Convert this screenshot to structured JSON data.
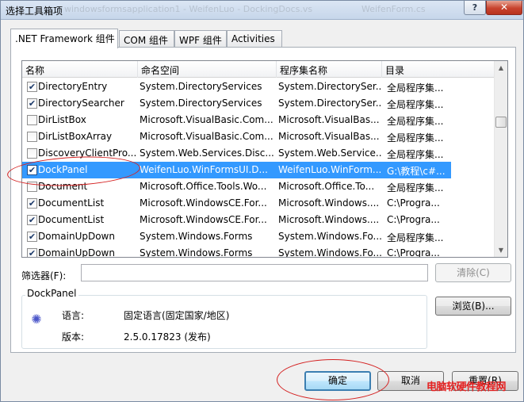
{
  "window": {
    "title": "选择工具箱项",
    "title_ghost": "windowsformsapplication1 - WeifenLuo - DockingDocs.vs",
    "title_ghost2": "WeifenForm.cs",
    "help_label": "?",
    "close_label": "✕"
  },
  "tabs": [
    {
      "label": ".NET Framework 组件"
    },
    {
      "label": "COM 组件"
    },
    {
      "label": "WPF 组件"
    },
    {
      "label": "Activities"
    }
  ],
  "list": {
    "columns": [
      "名称",
      "命名空间",
      "程序集名称",
      "目录"
    ],
    "rows": [
      {
        "checked": true,
        "name": "DirectoryEntry",
        "ns": "System.DirectoryServices",
        "asm": "System.DirectorySer...",
        "dir": "全局程序集..."
      },
      {
        "checked": true,
        "name": "DirectorySearcher",
        "ns": "System.DirectoryServices",
        "asm": "System.DirectorySer...",
        "dir": "全局程序集..."
      },
      {
        "checked": false,
        "name": "DirListBox",
        "ns": "Microsoft.VisualBasic.Com...",
        "asm": "Microsoft.VisualBas...",
        "dir": "全局程序集..."
      },
      {
        "checked": false,
        "name": "DirListBoxArray",
        "ns": "Microsoft.VisualBasic.Com...",
        "asm": "Microsoft.VisualBas...",
        "dir": "全局程序集..."
      },
      {
        "checked": false,
        "name": "DiscoveryClientPro...",
        "ns": "System.Web.Services.Disc...",
        "asm": "System.Web.Service...",
        "dir": "全局程序集..."
      },
      {
        "checked": true,
        "name": "DockPanel",
        "ns": "WeifenLuo.WinFormsUI.D...",
        "asm": "WeifenLuo.WinForm...",
        "dir": "G:\\教程\\c#..."
      },
      {
        "checked": false,
        "name": "Document",
        "ns": "Microsoft.Office.Tools.Wo...",
        "asm": "Microsoft.Office.To...",
        "dir": "全局程序集..."
      },
      {
        "checked": true,
        "name": "DocumentList",
        "ns": "Microsoft.WindowsCE.For...",
        "asm": "Microsoft.Windows....",
        "dir": "C:\\Progra..."
      },
      {
        "checked": true,
        "name": "DocumentList",
        "ns": "Microsoft.WindowsCE.For...",
        "asm": "Microsoft.Windows....",
        "dir": "C:\\Progra..."
      },
      {
        "checked": true,
        "name": "DomainUpDown",
        "ns": "System.Windows.Forms",
        "asm": "System.Windows.Fo...",
        "dir": "全局程序集..."
      },
      {
        "checked": true,
        "name": "DomainUpDown",
        "ns": "System.Windows.Forms",
        "asm": "System.Windows.Fo...",
        "dir": "C:\\Progra..."
      }
    ]
  },
  "filter": {
    "label": "筛选器(F):",
    "value": "",
    "clear_label": "清除(C)"
  },
  "details": {
    "title": "DockPanel",
    "language_label": "语言:",
    "language_value": "固定语言(固定国家/地区)",
    "version_label": "版本:",
    "version_value": "2.5.0.17823 (发布)"
  },
  "browse_label": "浏览(B)...",
  "buttons": {
    "ok": "确定",
    "cancel": "取消",
    "reset": "重置(R)"
  },
  "watermark": "电脑软硬件教程网",
  "colors": {
    "selection": "#3399ff",
    "annotation": "#d42121"
  }
}
